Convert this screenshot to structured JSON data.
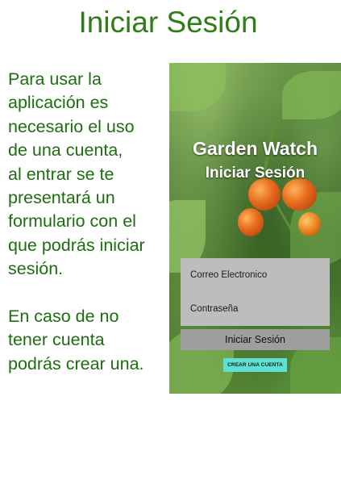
{
  "page": {
    "title": "Iniciar Sesión",
    "paragraph_1": "Para usar la\naplicación es\nnecesario el uso\nde una cuenta,\nal entrar se te\npresentará un\nformulario con el\nque podrás iniciar\nsesión.",
    "paragraph_2": "En caso de no\ntener cuenta\npodrás crear una."
  },
  "app_screen": {
    "app_name": "Garden Watch",
    "screen_title": "Iniciar Sesión",
    "email_placeholder": "Correo Electronico",
    "password_placeholder": "Contraseña",
    "login_label": "Iniciar Sesión",
    "create_account_label": "CREAR UNA CUENTA"
  },
  "colors": {
    "title_green": "#2e7d16",
    "text_green": "#1d6e10",
    "panel_gray": "#bdbdbd",
    "button_gray": "#9e9e9e",
    "create_button_cyan": "#5ee0d6"
  }
}
